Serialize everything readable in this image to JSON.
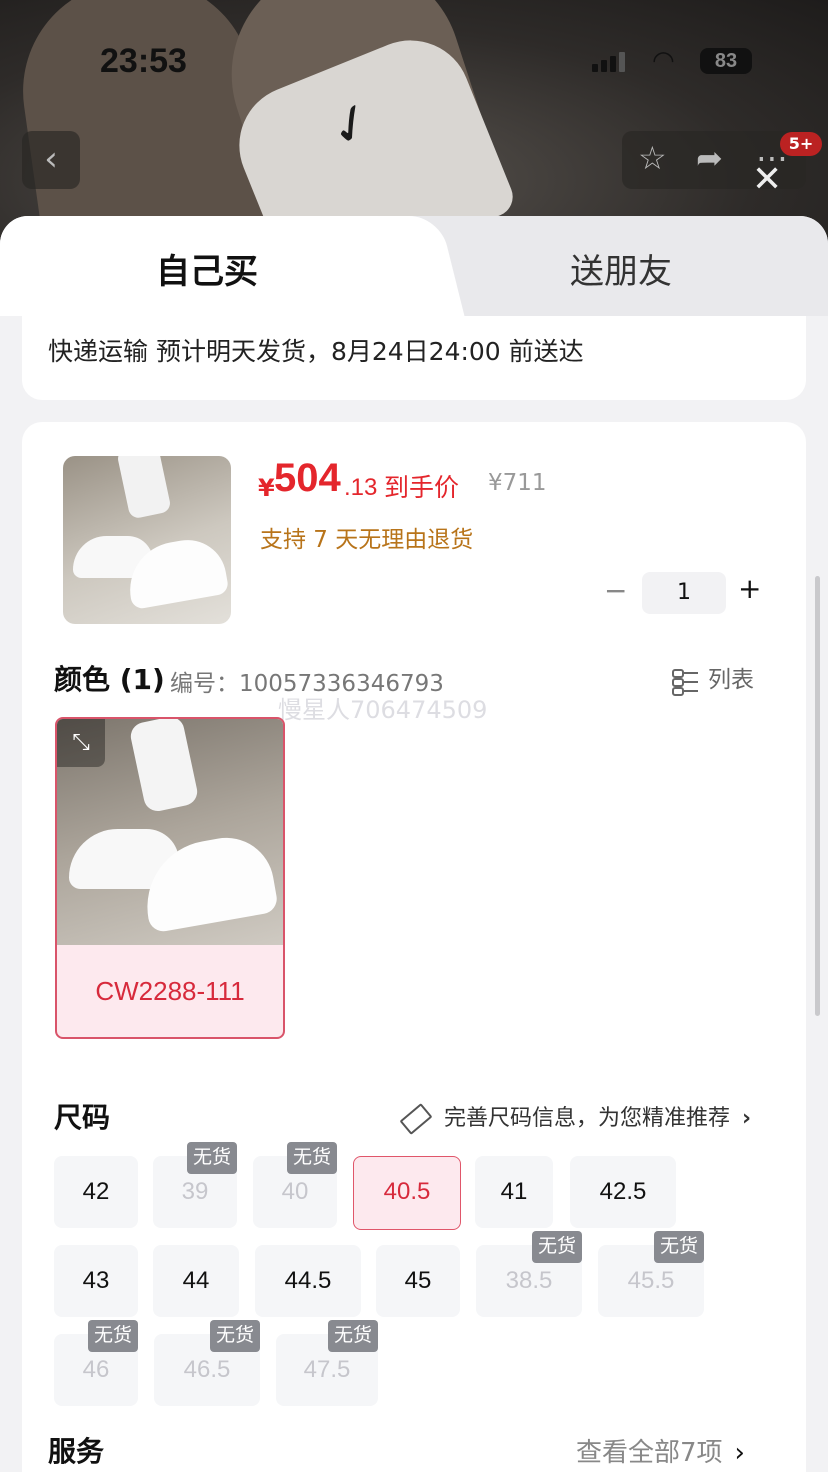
{
  "status_bar": {
    "time": "23:53",
    "battery": "83"
  },
  "nav": {
    "back_icon": "‹",
    "badge": "5+"
  },
  "tabs": [
    {
      "label": "自己买"
    },
    {
      "label": "送朋友"
    }
  ],
  "shipping": {
    "text": "快递运输 预计明天发货，8月24日24:00 前送达"
  },
  "product": {
    "currency": "¥",
    "price_int": "504",
    "price_dec": ".13",
    "price_label": "到手价",
    "original_price": "¥711",
    "return_policy": "支持 7 天无理由退货",
    "quantity": "1"
  },
  "color_section": {
    "title": "颜色 (1)",
    "sku": "编号：10057336346793",
    "list_label": "列表",
    "watermark": "慢星人706474509",
    "variant_label": "CW2288-111"
  },
  "size_section": {
    "title": "尺码",
    "hint": "完善尺码信息，为您精准推荐",
    "oos_tag": "无货",
    "sizes": [
      {
        "label": "42",
        "state": "available"
      },
      {
        "label": "39",
        "state": "out_of_stock"
      },
      {
        "label": "40",
        "state": "out_of_stock"
      },
      {
        "label": "40.5",
        "state": "selected"
      },
      {
        "label": "41",
        "state": "available"
      },
      {
        "label": "42.5",
        "state": "available"
      },
      {
        "label": "43",
        "state": "available"
      },
      {
        "label": "44",
        "state": "available"
      },
      {
        "label": "44.5",
        "state": "available"
      },
      {
        "label": "45",
        "state": "available"
      },
      {
        "label": "38.5",
        "state": "out_of_stock"
      },
      {
        "label": "45.5",
        "state": "out_of_stock"
      },
      {
        "label": "46",
        "state": "out_of_stock"
      },
      {
        "label": "46.5",
        "state": "out_of_stock"
      },
      {
        "label": "47.5",
        "state": "out_of_stock"
      }
    ]
  },
  "service": {
    "title": "服务",
    "more": "查看全部7项"
  },
  "colors": {
    "accent_red": "#e4262c",
    "selected_red": "#d72a3c",
    "selected_bg": "#fde9ee",
    "policy_orange": "#b8741a"
  }
}
